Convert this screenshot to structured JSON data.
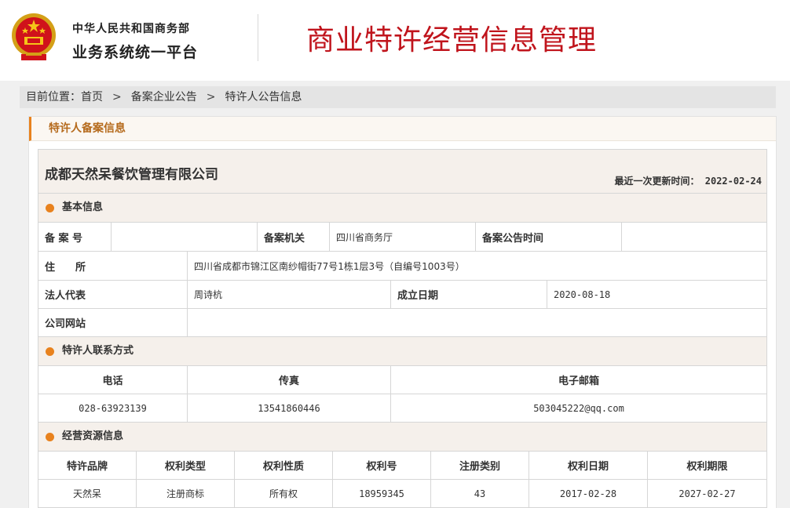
{
  "header": {
    "org_name": "中华人民共和国商务部",
    "platform_name": "业务系统统一平台",
    "system_title": "商业特许经营信息管理",
    "emblem_icon": "national-emblem-icon"
  },
  "breadcrumb": {
    "prefix": "目前位置：",
    "items": [
      "首页",
      "备案企业公告",
      "特许人公告信息"
    ],
    "separator": ">"
  },
  "panel": {
    "title": "特许人备案信息"
  },
  "company": {
    "name": "成都天然呆餐饮管理有限公司",
    "update_label": "最近一次更新时间：",
    "update_date": "2022-02-24"
  },
  "basic": {
    "section_title": "基本信息",
    "record_no_label": "备 案 号",
    "record_no": "",
    "authority_label": "备案机关",
    "authority": "四川省商务厅",
    "announce_time_label": "备案公告时间",
    "announce_time": "",
    "address_label": "住　　所",
    "address": "四川省成都市锦江区南纱帽街77号1栋1层3号（自编号1003号）",
    "legal_rep_label": "法人代表",
    "legal_rep": "周诗杭",
    "founded_label": "成立日期",
    "founded": "2020-08-18",
    "website_label": "公司网站",
    "website": ""
  },
  "contact": {
    "section_title": "特许人联系方式",
    "headers": [
      "电话",
      "传真",
      "电子邮箱"
    ],
    "values": [
      "028-63923139",
      "13541860446",
      "503045222@qq.com"
    ]
  },
  "resources": {
    "section_title": "经营资源信息",
    "headers": [
      "特许品牌",
      "权利类型",
      "权利性质",
      "权利号",
      "注册类别",
      "权利日期",
      "权利期限"
    ],
    "rows": [
      [
        "天然呆",
        "注册商标",
        "所有权",
        "18959345",
        "43",
        "2017-02-28",
        "2027-02-27"
      ]
    ]
  },
  "colors": {
    "accent": "#e8821e",
    "title_red": "#c0141c",
    "section_bg": "#f5f0eb"
  }
}
